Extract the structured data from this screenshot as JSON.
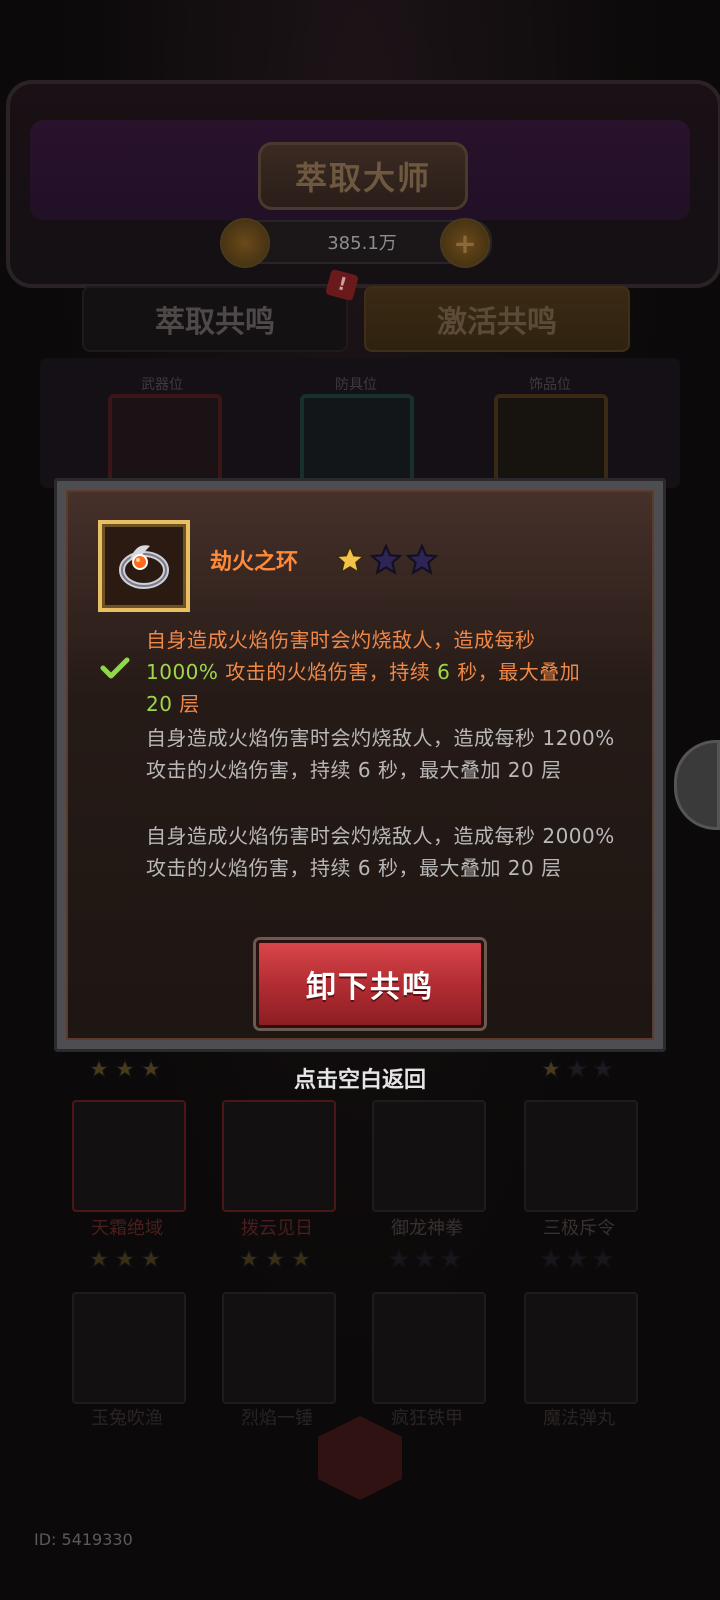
{
  "header": {
    "title": "萃取大师",
    "currency": "385.1万",
    "plus_label": "+"
  },
  "badge": "!",
  "tabs": [
    {
      "label": "萃取共鸣"
    },
    {
      "label": "激活共鸣"
    }
  ],
  "slots": [
    {
      "label": "武器位"
    },
    {
      "label": "防具位"
    },
    {
      "label": "饰品位"
    }
  ],
  "popup": {
    "item_name": "劫火之环",
    "stars": [
      "gold",
      "purple",
      "purple"
    ],
    "effects": [
      {
        "pre": "自身造成火焰伤害时会灼烧敌人，造成每秒",
        "pct": "1000%",
        "mid": " 攻击的火焰伤害，持续 ",
        "dur": "6",
        "post": " 秒，最大叠加",
        "stack": "20",
        "unit": " 层",
        "active": true
      },
      {
        "text": "自身造成火焰伤害时会灼烧敌人，造成每秒 1200% 攻击的火焰伤害，持续 6 秒，最大叠加 20 层",
        "active": false
      },
      {
        "text": "自身造成火焰伤害时会灼烧敌人，造成每秒 2000% 攻击的火焰伤害，持续 6 秒，最大叠加 20 层",
        "active": false
      }
    ],
    "button_label": "卸下共鸣"
  },
  "hint": "点击空白返回",
  "grid": {
    "row1": [
      {
        "name": "天霜绝域"
      },
      {
        "name": "拨云见日"
      },
      {
        "name": "御龙神拳"
      },
      {
        "name": "三极斥令"
      }
    ],
    "row2": [
      {
        "name": "玉兔吹渔"
      },
      {
        "name": "烈焰一锤"
      },
      {
        "name": "疯狂铁甲"
      },
      {
        "name": "魔法弹丸"
      }
    ]
  },
  "footer": {
    "id": "ID: 5419330"
  },
  "colors": {
    "accent_orange": "#ff8a3a",
    "highlight_green": "#9ed84a",
    "button_red": "#c0323a"
  }
}
